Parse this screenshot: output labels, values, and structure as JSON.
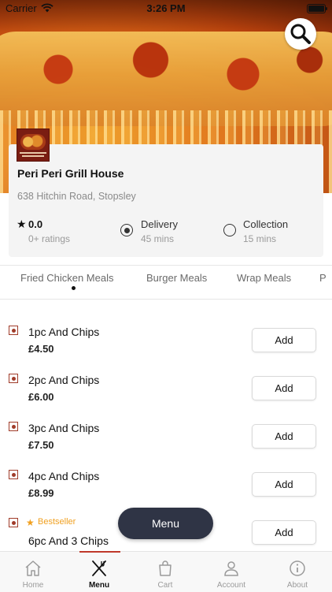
{
  "status_bar": {
    "carrier": "Carrier",
    "time": "3:26 PM"
  },
  "restaurant": {
    "name": "Peri Peri Grill House",
    "address": "638 Hitchin Road, Stopsley",
    "rating": "0.0",
    "ratings_count": "0+ ratings"
  },
  "order_options": {
    "delivery": {
      "label": "Delivery",
      "time": "45 mins",
      "selected": true
    },
    "collection": {
      "label": "Collection",
      "time": "15 mins",
      "selected": false
    }
  },
  "category_tabs": [
    "Fried Chicken Meals",
    "Burger Meals",
    "Wrap Meals",
    "P"
  ],
  "active_tab": "Fried Chicken Meals",
  "menu_items": [
    {
      "name": "1pc And Chips",
      "price": "£4.50",
      "add_label": "Add"
    },
    {
      "name": "2pc And Chips",
      "price": "£6.00",
      "add_label": "Add"
    },
    {
      "name": "3pc And Chips",
      "price": "£7.50",
      "add_label": "Add"
    },
    {
      "name": "4pc And Chips",
      "price": "£8.99",
      "add_label": "Add"
    },
    {
      "name": "6pc And 3 Chips",
      "badge": "Bestseller",
      "add_label": "Add"
    }
  ],
  "menu_button": "Menu",
  "bottom_nav": [
    {
      "label": "Home",
      "icon": "home-icon"
    },
    {
      "label": "Menu",
      "icon": "fork-knife-icon",
      "active": true
    },
    {
      "label": "Cart",
      "icon": "shopping-bag-icon"
    },
    {
      "label": "Account",
      "icon": "user-icon"
    },
    {
      "label": "About",
      "icon": "info-icon"
    }
  ],
  "colors": {
    "accent": "#c0392b",
    "fab": "#2f3445",
    "bestseller": "#f0a020"
  }
}
